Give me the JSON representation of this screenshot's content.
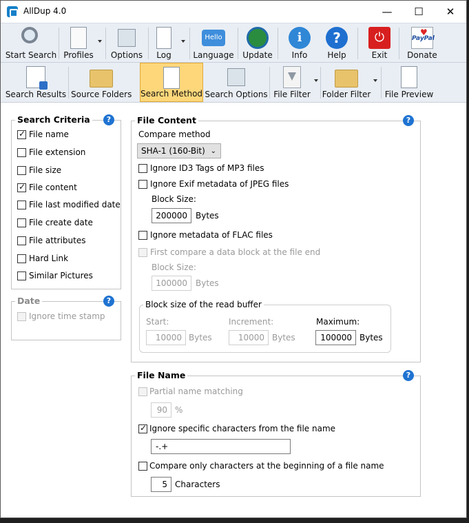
{
  "window": {
    "title": "AllDup 4.0",
    "minimize": "—",
    "maximize": "☐",
    "close": "✕"
  },
  "toolbar_main": {
    "start_search": "Start Search",
    "profiles": "Profiles",
    "options": "Options",
    "log": "Log",
    "language": "Language",
    "language_icon_text": "Hello",
    "update": "Update",
    "info": "Info",
    "help": "Help",
    "exit": "Exit",
    "donate": "Donate",
    "paypal_text": "PayPal"
  },
  "toolbar_sub": {
    "search_results": "Search Results",
    "source_folders": "Source Folders",
    "search_method": "Search Method",
    "search_options": "Search Options",
    "file_filter": "File Filter",
    "folder_filter": "Folder Filter",
    "file_preview": "File Preview"
  },
  "search_criteria": {
    "title": "Search Criteria",
    "items": [
      {
        "label": "File name",
        "checked": true
      },
      {
        "label": "File extension",
        "checked": false
      },
      {
        "label": "File size",
        "checked": false
      },
      {
        "label": "File content",
        "checked": true
      },
      {
        "label": "File last modified date",
        "checked": false
      },
      {
        "label": "File create date",
        "checked": false
      },
      {
        "label": "File attributes",
        "checked": false
      },
      {
        "label": "Hard Link",
        "checked": false
      },
      {
        "label": "Similar Pictures",
        "checked": false
      }
    ]
  },
  "date": {
    "title": "Date",
    "ignore_time_stamp": "Ignore time stamp"
  },
  "file_content": {
    "title": "File Content",
    "compare_method_label": "Compare method",
    "compare_method_value": "SHA-1 (160-Bit)",
    "ignore_id3": "Ignore ID3 Tags of MP3 files",
    "ignore_exif": "Ignore Exif metadata of JPEG files",
    "block_size_label": "Block Size:",
    "block_size_value": "200000",
    "bytes": "Bytes",
    "ignore_flac": "Ignore metadata of FLAC files",
    "first_compare": "First compare a data block at the file end",
    "block_size2_label": "Block Size:",
    "block_size2_value": "100000",
    "read_buffer": {
      "title": "Block size of the read buffer",
      "start_label": "Start:",
      "start_value": "10000",
      "increment_label": "Increment:",
      "increment_value": "10000",
      "maximum_label": "Maximum:",
      "maximum_value": "100000"
    }
  },
  "file_name": {
    "title": "File Name",
    "partial_matching": "Partial name matching",
    "percent_value": "90",
    "percent_unit": "%",
    "ignore_chars": "Ignore specific characters from the file name",
    "ignore_chars_value": "-.+",
    "compare_beginning": "Compare only characters at the beginning of a file name",
    "chars_value": "5",
    "chars_unit": "Characters"
  },
  "help_glyph": "?"
}
